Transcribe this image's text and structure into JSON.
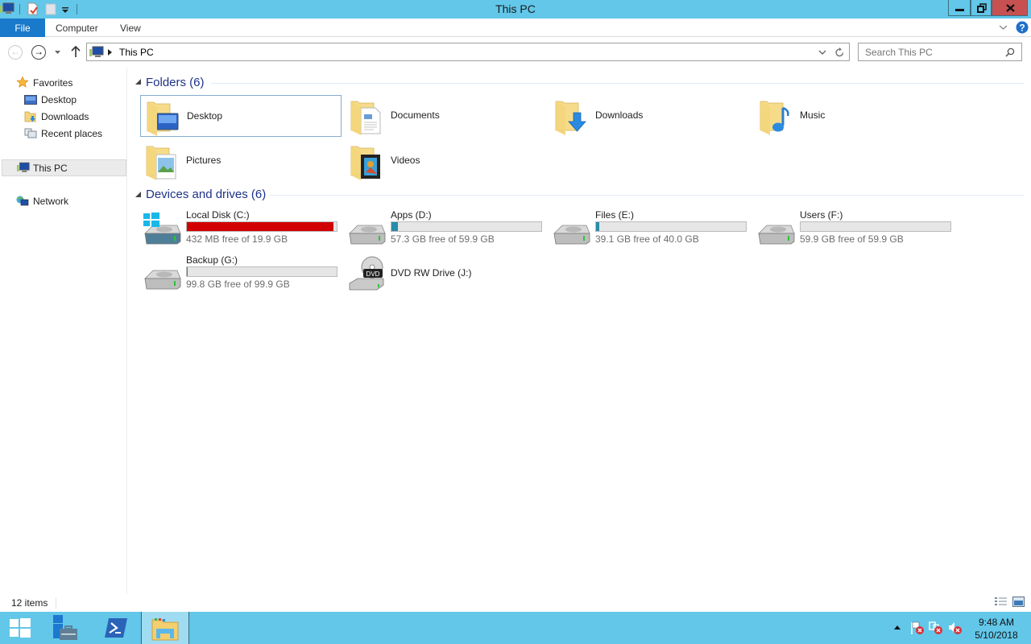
{
  "window": {
    "title": "This PC",
    "controls": {
      "minimize": "minimize",
      "maximize": "restore",
      "close": "close"
    }
  },
  "ribbon": {
    "tabs": [
      {
        "label": "File",
        "active": true
      },
      {
        "label": "Computer"
      },
      {
        "label": "View"
      }
    ]
  },
  "address": {
    "path": "This PC",
    "search_placeholder": "Search This PC"
  },
  "nav_pane": {
    "favorites_label": "Favorites",
    "favorites": [
      "Desktop",
      "Downloads",
      "Recent places"
    ],
    "this_pc": "This PC",
    "network": "Network"
  },
  "folders": {
    "header": "Folders (6)",
    "items": [
      "Desktop",
      "Documents",
      "Downloads",
      "Music",
      "Pictures",
      "Videos"
    ],
    "selected": "Desktop"
  },
  "drives": {
    "header": "Devices and drives (6)",
    "items": [
      {
        "name": "Local Disk (C:)",
        "free": "432 MB free of 19.9 GB",
        "used_fraction": 0.979,
        "bar_color": "#d20000"
      },
      {
        "name": "Apps (D:)",
        "free": "57.3 GB free of 59.9 GB",
        "used_fraction": 0.043,
        "bar_color": "#268dab"
      },
      {
        "name": "Files (E:)",
        "free": "39.1 GB free of 40.0 GB",
        "used_fraction": 0.022,
        "bar_color": "#268dab"
      },
      {
        "name": "Users (F:)",
        "free": "59.9 GB free of 59.9 GB",
        "used_fraction": 0.0,
        "bar_color": "#268dab"
      },
      {
        "name": "Backup (G:)",
        "free": "99.8 GB free of 99.9 GB",
        "used_fraction": 0.001,
        "bar_color": "#268dab"
      },
      {
        "name": "DVD RW Drive (J:)"
      }
    ]
  },
  "status": {
    "item_count": "12 items"
  },
  "taskbar": {
    "clock_time": "9:48 AM",
    "clock_date": "5/10/2018"
  },
  "colors": {
    "titlebar": "#62c7e9",
    "file_tab": "#1979ca",
    "section_header": "#1e3287",
    "close_button": "#c75050"
  }
}
